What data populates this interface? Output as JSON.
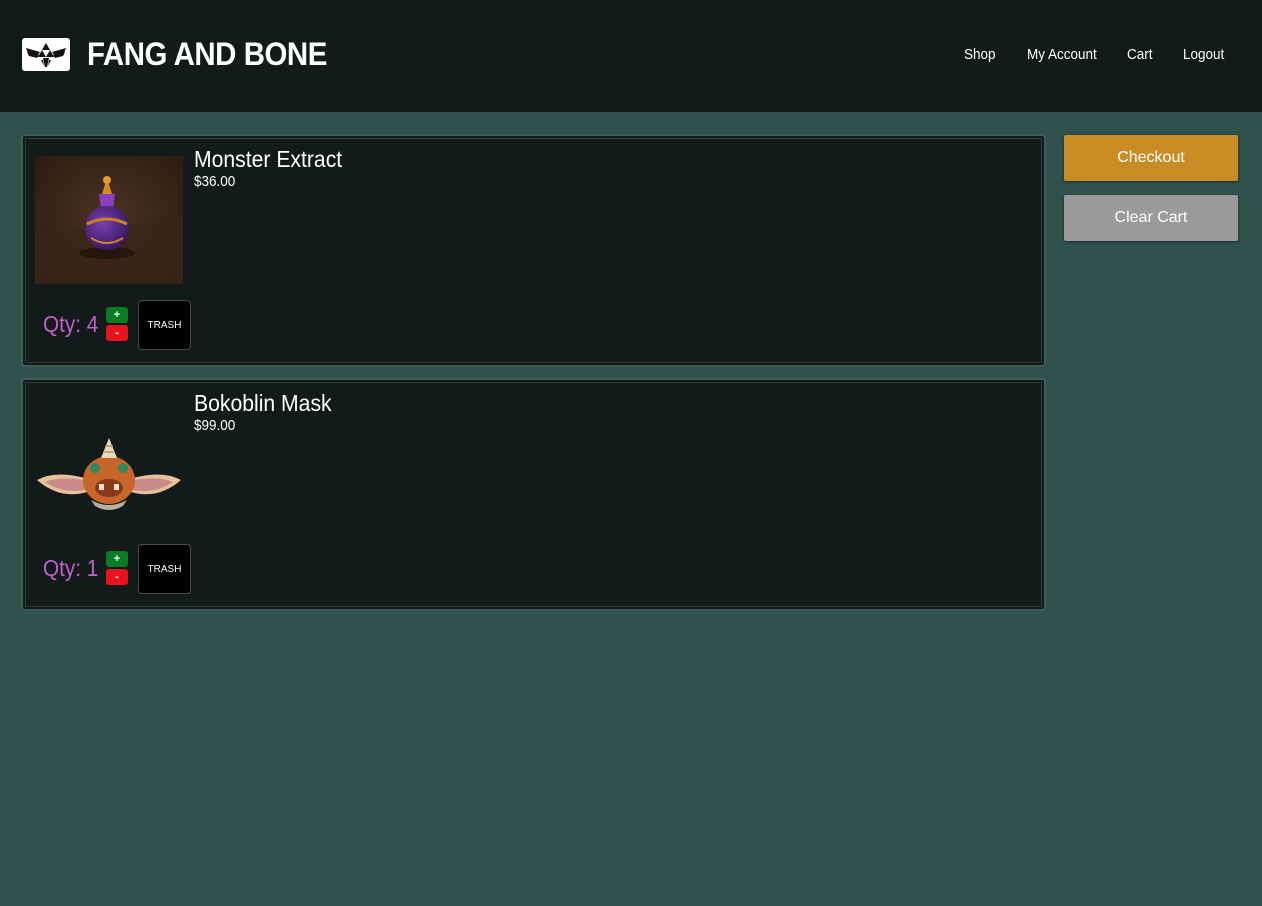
{
  "header": {
    "brand": "FANG AND BONE",
    "logo_icon": "triforce-crest-icon",
    "nav": [
      {
        "label": "Shop"
      },
      {
        "label": "My Account"
      },
      {
        "label": "Cart"
      },
      {
        "label": "Logout"
      }
    ]
  },
  "cart": {
    "items": [
      {
        "name": "Monster Extract",
        "price": "$36.00",
        "qty_label": "Qty: 4",
        "plus_label": "+",
        "minus_label": "-",
        "trash_label": "TRASH",
        "image_icon": "potion-bottle-image"
      },
      {
        "name": "Bokoblin Mask",
        "price": "$99.00",
        "qty_label": "Qty: 1",
        "plus_label": "+",
        "minus_label": "-",
        "trash_label": "TRASH",
        "image_icon": "bokoblin-mask-image"
      }
    ]
  },
  "actions": {
    "checkout_label": "Checkout",
    "clear_label": "Clear Cart"
  },
  "colors": {
    "page_bg": "#2f524b",
    "header_bg": "#121a1a",
    "qty_text": "#c35fcb",
    "plus_bg": "#0c7b23",
    "minus_bg": "#e8131d",
    "checkout_bg": "#c98c25",
    "clear_bg": "#9b9b9b"
  }
}
